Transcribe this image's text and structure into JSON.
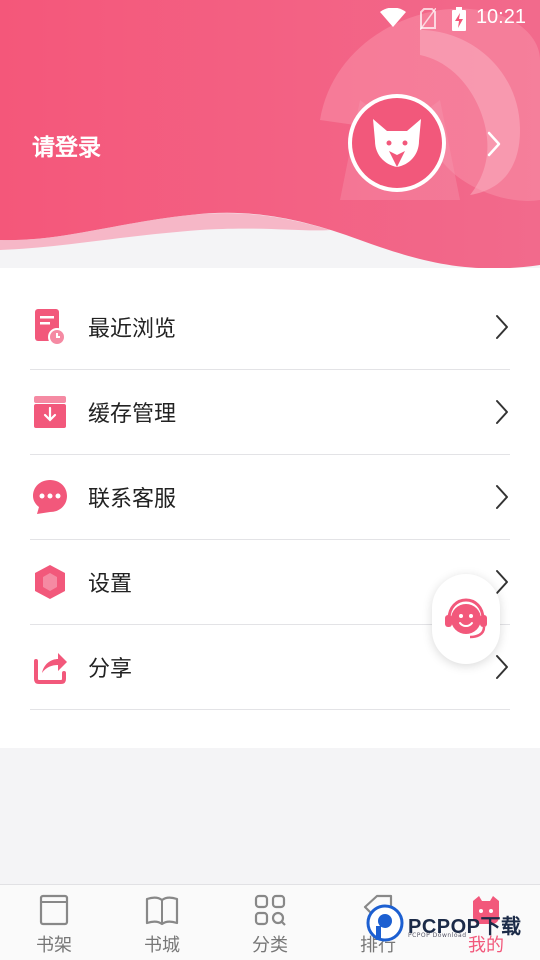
{
  "status_bar": {
    "time": "10:21"
  },
  "profile": {
    "login_text": "请登录"
  },
  "menu": [
    {
      "label": "最近浏览",
      "icon": "recent-history-icon"
    },
    {
      "label": "缓存管理",
      "icon": "cache-download-icon"
    },
    {
      "label": "联系客服",
      "icon": "chat-bubble-icon"
    },
    {
      "label": "设置",
      "icon": "settings-hexagon-icon"
    },
    {
      "label": "分享",
      "icon": "share-icon"
    }
  ],
  "tabs": [
    {
      "label": "书架",
      "icon": "bookshelf-icon"
    },
    {
      "label": "书城",
      "icon": "open-book-icon"
    },
    {
      "label": "分类",
      "icon": "category-grid-icon"
    },
    {
      "label": "排行",
      "icon": "ranking-tag-icon"
    },
    {
      "label": "我的",
      "icon": "mine-face-icon",
      "active": true
    }
  ],
  "watermark": {
    "text": "PCPOP下载",
    "sub": "PCPOP Download"
  },
  "colors": {
    "accent": "#f2587b",
    "accent_light": "#f79ab2",
    "text": "#222222"
  }
}
